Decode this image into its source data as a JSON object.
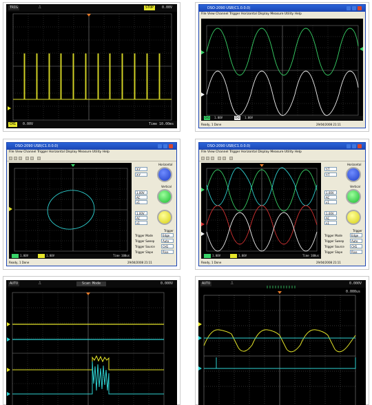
{
  "panels": {
    "p1": {
      "ch1_label": "TRIG",
      "time_label": "0.00V",
      "mode_label": "STOP",
      "bottom_left": "CH1",
      "bottom_v": "0.00V",
      "bottom_right": "Time 10.00ms"
    },
    "p2": {
      "title": "DSO-2090 USB(C1.0.0.0)",
      "menu": "File  View  Channel  Trigger  Horizontal  Display  Measure  Utility  Help",
      "status_left": "Ready, 1 Done",
      "status_right": "29/04/2008  21:11",
      "ch1": "CH1",
      "ch1v": "1.00V",
      "ch2": "CH2",
      "ch2v": "1.00V"
    },
    "p3": {
      "title": "DSO-2090 USB(C1.0.0.0)",
      "menu": "File  View  Channel  Trigger  Horizontal  Display  Measure  Utility  Help",
      "status_left": "Ready, 1 Done",
      "status_right": "29/04/2008  21:11",
      "ch1v": "1.00V",
      "ch2v": "1.00V",
      "time": "Time 100us",
      "horizontal": "Horizontal",
      "vertical": "Vertical",
      "trigger": "Trigger",
      "trig_mode": "Trigger Mode",
      "trig_sweep": "Trigger Sweep",
      "trig_source": "Trigger Source",
      "trig_slope": "Trigger Slope",
      "opt_edge": "Edge",
      "opt_auto": "Auto",
      "opt_ch1": "CH1",
      "opt_rise": "Rise",
      "sel_a": "X-Y",
      "sel_b": "1.00V",
      "sel_c": "AC",
      "sel_d": "x1"
    },
    "p4": {
      "title": "DSO-2090 USB(C1.0.0.0)",
      "menu": "File  View  Channel  Trigger  Horizontal  Display  Measure  Utility  Help",
      "status_left": "Ready, 1 Done",
      "status_right": "29/04/2008  21:11",
      "ch1v": "1.00V",
      "ch2v": "1.00V",
      "time": "Time 100us",
      "horizontal": "Horizontal",
      "vertical": "Vertical",
      "trigger": "Trigger",
      "trig_mode": "Trigger Mode",
      "trig_sweep": "Trigger Sweep",
      "trig_source": "Trigger Source",
      "trig_slope": "Trigger Slope",
      "opt_edge": "Edge",
      "opt_auto": "Auto",
      "opt_ch1": "CH1",
      "opt_rise": "Rise",
      "sel_a": "Y-T",
      "sel_b": "1.00V",
      "sel_c": "AC",
      "sel_d": "x1"
    },
    "p5": {
      "mode": "AUTO",
      "center": "Scan Mode",
      "right": "0.000V"
    },
    "p6": {
      "mode": "AUTO",
      "right": "0.000V",
      "top_right": "0.000us"
    }
  },
  "colors": {
    "ch1": "#e6e629",
    "ch2": "#2fd3d3",
    "green": "#39d468",
    "red": "#d43232",
    "white": "#f2f2f2",
    "grid": "#555555"
  }
}
